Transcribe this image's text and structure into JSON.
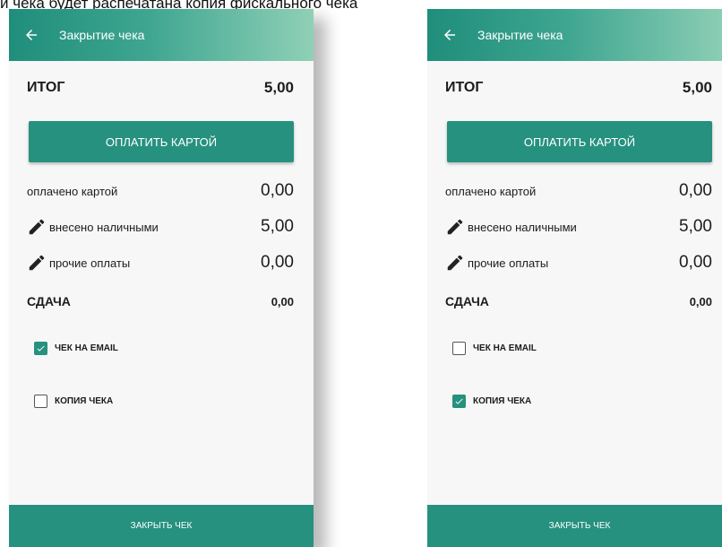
{
  "top_caption": "и чека будет распечатана копия фискального чека",
  "colors": {
    "accent": "#26917e",
    "appbar_start": "#1f8e7b",
    "appbar_end": "#8fd0b6"
  },
  "left_screen": {
    "header": {
      "title": "Закрытие чека",
      "back_icon": "arrow-left"
    },
    "total": {
      "label": "ИТОГ",
      "value": "5,00"
    },
    "pay_card_button": "ОПЛАТИТЬ КАРТОЙ",
    "paid_card": {
      "label": "оплачено картой",
      "value": "0,00"
    },
    "cash": {
      "label": "внесено наличными",
      "value": "5,00"
    },
    "other": {
      "label": "прочие оплаты",
      "value": "0,00"
    },
    "change": {
      "label": "СДАЧА",
      "value": "0,00"
    },
    "email_check": {
      "label": "ЧЕК НА EMAIL",
      "checked": true
    },
    "copy_check": {
      "label": "КОПИЯ ЧЕКА",
      "checked": false
    },
    "close_button": "ЗАКРЫТЬ ЧЕК"
  },
  "right_screen": {
    "header": {
      "title": "Закрытие чека",
      "back_icon": "arrow-left"
    },
    "total": {
      "label": "ИТОГ",
      "value": "5,00"
    },
    "pay_card_button": "ОПЛАТИТЬ КАРТОЙ",
    "paid_card": {
      "label": "оплачено картой",
      "value": "0,00"
    },
    "cash": {
      "label": "внесено наличными",
      "value": "5,00"
    },
    "other": {
      "label": "прочие оплаты",
      "value": "0,00"
    },
    "change": {
      "label": "СДАЧА",
      "value": "0,00"
    },
    "email_check": {
      "label": "ЧЕК НА EMAIL",
      "checked": false
    },
    "copy_check": {
      "label": "КОПИЯ ЧЕКА",
      "checked": true
    },
    "close_button": "ЗАКРЫТЬ ЧЕК"
  }
}
